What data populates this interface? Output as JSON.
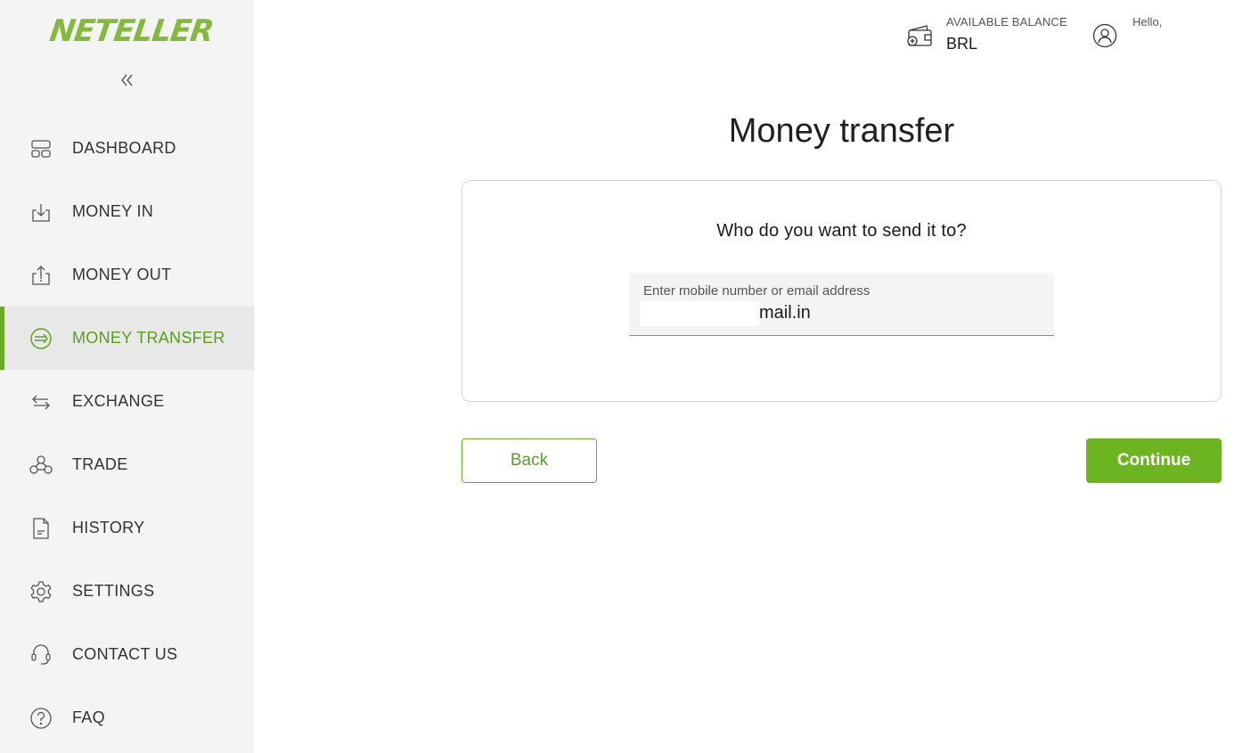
{
  "brand": {
    "name": "NETELLER",
    "color": "#83ba3b"
  },
  "sidebar": {
    "collapse_icon": "double-chevron-left-icon",
    "items": [
      {
        "label": "DASHBOARD",
        "icon": "dashboard-icon",
        "active": false
      },
      {
        "label": "MONEY IN",
        "icon": "download-tray-icon",
        "active": false
      },
      {
        "label": "MONEY OUT",
        "icon": "upload-tray-icon",
        "active": false
      },
      {
        "label": "MONEY TRANSFER",
        "icon": "transfer-arrow-icon",
        "active": true
      },
      {
        "label": "EXCHANGE",
        "icon": "exchange-arrows-icon",
        "active": false
      },
      {
        "label": "TRADE",
        "icon": "network-nodes-icon",
        "active": false
      },
      {
        "label": "HISTORY",
        "icon": "document-icon",
        "active": false
      },
      {
        "label": "SETTINGS",
        "icon": "gear-icon",
        "active": false
      },
      {
        "label": "CONTACT US",
        "icon": "headset-icon",
        "active": false
      },
      {
        "label": "FAQ",
        "icon": "question-circle-icon",
        "active": false
      }
    ]
  },
  "header": {
    "balance_label": "AVAILABLE BALANCE",
    "balance_value": "BRL",
    "greeting": "Hello,"
  },
  "main": {
    "title": "Money transfer",
    "question": "Who do you want to send it to?",
    "recipient_input": {
      "label": "Enter mobile number or email address",
      "value": "mail.in"
    },
    "back_label": "Back",
    "continue_label": "Continue"
  },
  "colors": {
    "accent": "#6cb520",
    "active_text": "#5a9e1e",
    "sidebar_bg": "#f4f4f4"
  }
}
